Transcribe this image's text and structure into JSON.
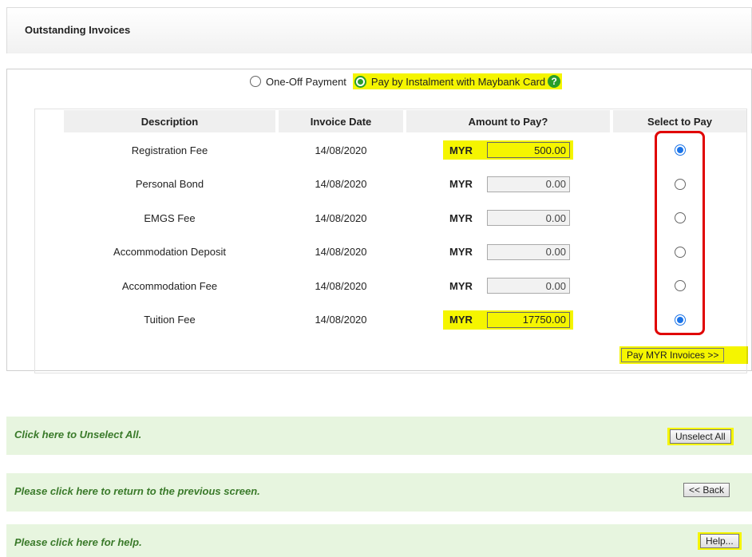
{
  "header": {
    "title": "Outstanding Invoices"
  },
  "payment_options": [
    {
      "label": "One-Off Payment",
      "selected": false
    },
    {
      "label": "Pay by Instalment with Maybank Card",
      "selected": true
    }
  ],
  "help_icon": "question-circle-icon",
  "table": {
    "columns": [
      "Description",
      "Invoice Date",
      "Amount to Pay?",
      "Select to Pay"
    ],
    "rows": [
      {
        "description": "Registration Fee",
        "date": "14/08/2020",
        "currency": "MYR",
        "amount": "500.00",
        "selected": true
      },
      {
        "description": "Personal Bond",
        "date": "14/08/2020",
        "currency": "MYR",
        "amount": "0.00",
        "selected": false
      },
      {
        "description": "EMGS Fee",
        "date": "14/08/2020",
        "currency": "MYR",
        "amount": "0.00",
        "selected": false
      },
      {
        "description": "Accommodation Deposit",
        "date": "14/08/2020",
        "currency": "MYR",
        "amount": "0.00",
        "selected": false
      },
      {
        "description": "Accommodation Fee",
        "date": "14/08/2020",
        "currency": "MYR",
        "amount": "0.00",
        "selected": false
      },
      {
        "description": "Tuition Fee",
        "date": "14/08/2020",
        "currency": "MYR",
        "amount": "17750.00",
        "selected": true
      }
    ]
  },
  "pay_button": "Pay MYR Invoices >>",
  "info_rows": [
    {
      "text": "Click here to Unselect All.",
      "button": "Unselect All"
    },
    {
      "text": "Please click here to return to the previous screen.",
      "button": "<< Back"
    },
    {
      "text": "Please click here for help.",
      "button": "Help..."
    }
  ],
  "colors": {
    "highlight": "#f5f500",
    "info_bg": "#e7f5df",
    "info_text": "#3a7a2a",
    "selection_box": "#e00000",
    "radio_selected": "#1a73e8"
  }
}
